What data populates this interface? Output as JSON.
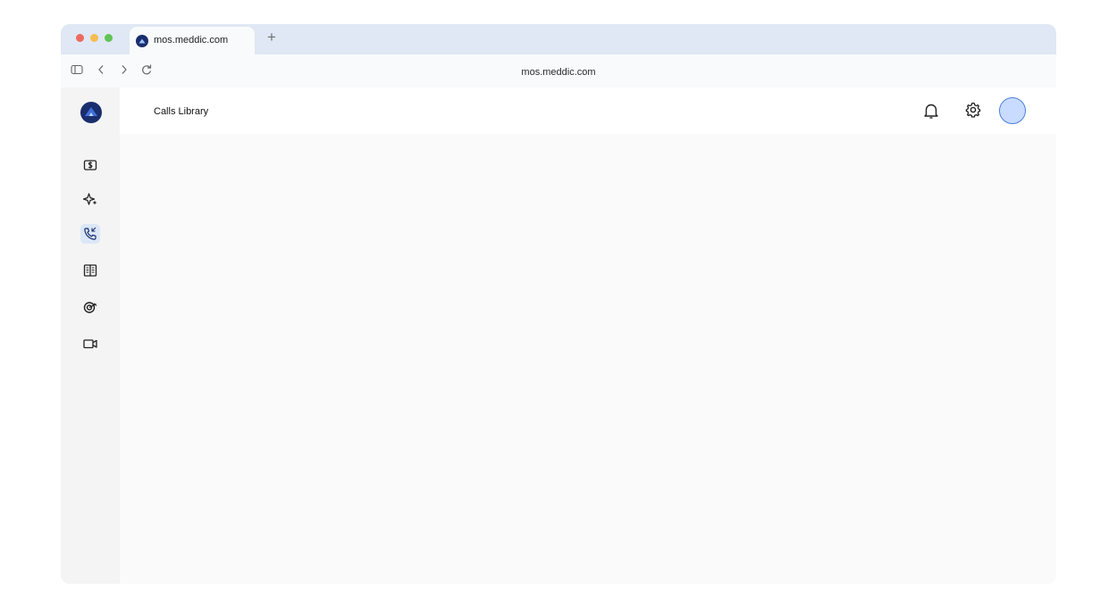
{
  "browser": {
    "tab_title": "mos.meddic.com",
    "new_tab_symbol": "+",
    "url": "mos.meddic.com",
    "toolbar_icons": [
      "sidebar-toggle-icon",
      "back-icon",
      "forward-icon",
      "reload-icon"
    ]
  },
  "app": {
    "page_title": "Calls Library",
    "accent_color": "#dbe7f7",
    "logo_color": "#1a2e6e",
    "sidebar": {
      "items": [
        {
          "icon": "money-icon",
          "active": false
        },
        {
          "icon": "sparkle-icon",
          "active": false
        },
        {
          "icon": "phone-calls-icon",
          "active": true
        },
        {
          "icon": "book-icon",
          "active": false
        },
        {
          "icon": "target-icon",
          "active": false
        },
        {
          "icon": "video-icon",
          "active": false
        }
      ]
    },
    "header_actions": [
      "bell-icon",
      "gear-icon",
      "avatar"
    ]
  }
}
